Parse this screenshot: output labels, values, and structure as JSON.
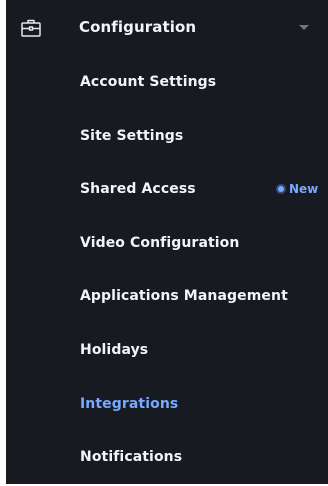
{
  "section": {
    "icon": "briefcase-icon",
    "label": "Configuration",
    "expanded_icon": "chevron-down-icon"
  },
  "items": [
    {
      "label": "Account Settings"
    },
    {
      "label": "Site Settings"
    },
    {
      "label": "Shared Access",
      "badge": "New"
    },
    {
      "label": "Video Configuration"
    },
    {
      "label": "Applications Management"
    },
    {
      "label": "Holidays"
    },
    {
      "label": "Integrations",
      "active": true
    },
    {
      "label": "Notifications"
    }
  ],
  "colors": {
    "panel_bg": "#171a21",
    "text": "#f2f4f8",
    "accent": "#78a9ff",
    "chevron": "#6f7682"
  }
}
